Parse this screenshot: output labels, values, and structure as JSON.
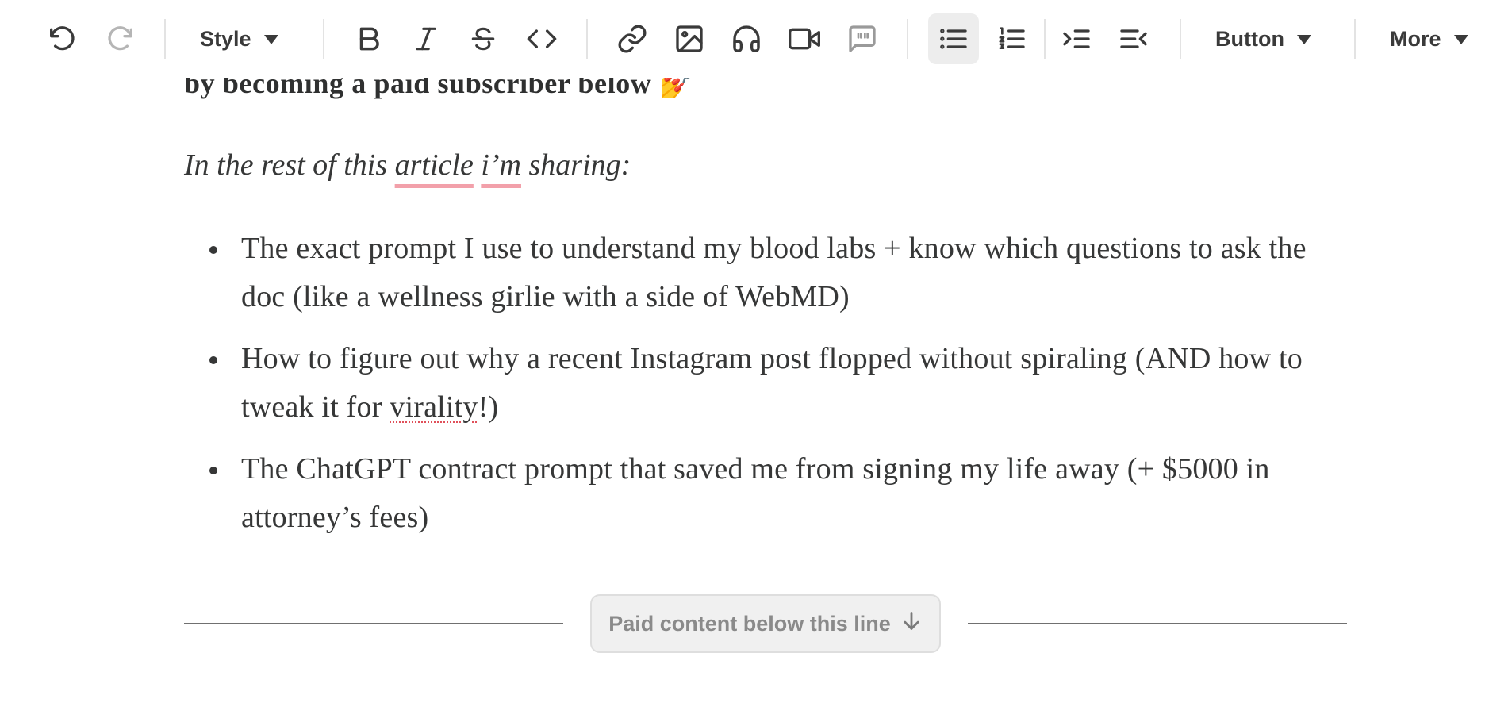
{
  "toolbar": {
    "style_label": "Style",
    "button_label": "Button",
    "more_label": "More"
  },
  "content": {
    "partial_heading": "by becoming a paid subscriber below 💅",
    "intro_pre": "In the rest of this ",
    "intro_word1": "article",
    "intro_space": " ",
    "intro_word2": "i’m",
    "intro_post": " sharing:",
    "bullets": [
      {
        "text": "The exact prompt I use to understand my blood labs + know which questions to ask the doc (like a wellness girlie with a side of WebMD)"
      },
      {
        "text_pre": "How to figure out why a recent Instagram post flopped without spiraling (AND how to tweak it for ",
        "text_mark": "virality",
        "text_post": "!)"
      },
      {
        "text": "The ChatGPT contract prompt that saved me from signing my life away (+ $5000 in attorney’s fees)"
      }
    ]
  },
  "paywall": {
    "label": "Paid content below this line",
    "arrow": "↓"
  },
  "colors": {
    "text": "#363737",
    "spell_underline": "#f2a0aa",
    "active_button_bg": "#ededed"
  }
}
